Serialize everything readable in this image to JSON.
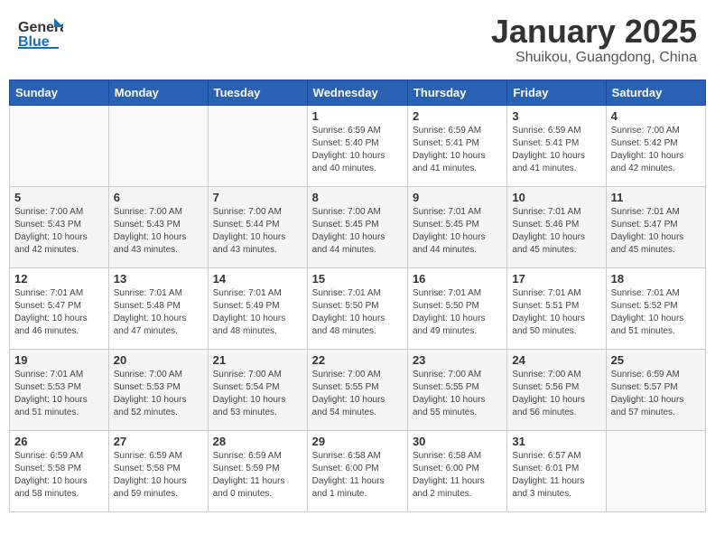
{
  "header": {
    "logo_general": "General",
    "logo_blue": "Blue",
    "month_title": "January 2025",
    "location": "Shuikou, Guangdong, China"
  },
  "days_of_week": [
    "Sunday",
    "Monday",
    "Tuesday",
    "Wednesday",
    "Thursday",
    "Friday",
    "Saturday"
  ],
  "weeks": [
    [
      {
        "day": "",
        "info": ""
      },
      {
        "day": "",
        "info": ""
      },
      {
        "day": "",
        "info": ""
      },
      {
        "day": "1",
        "info": "Sunrise: 6:59 AM\nSunset: 5:40 PM\nDaylight: 10 hours\nand 40 minutes."
      },
      {
        "day": "2",
        "info": "Sunrise: 6:59 AM\nSunset: 5:41 PM\nDaylight: 10 hours\nand 41 minutes."
      },
      {
        "day": "3",
        "info": "Sunrise: 6:59 AM\nSunset: 5:41 PM\nDaylight: 10 hours\nand 41 minutes."
      },
      {
        "day": "4",
        "info": "Sunrise: 7:00 AM\nSunset: 5:42 PM\nDaylight: 10 hours\nand 42 minutes."
      }
    ],
    [
      {
        "day": "5",
        "info": "Sunrise: 7:00 AM\nSunset: 5:43 PM\nDaylight: 10 hours\nand 42 minutes."
      },
      {
        "day": "6",
        "info": "Sunrise: 7:00 AM\nSunset: 5:43 PM\nDaylight: 10 hours\nand 43 minutes."
      },
      {
        "day": "7",
        "info": "Sunrise: 7:00 AM\nSunset: 5:44 PM\nDaylight: 10 hours\nand 43 minutes."
      },
      {
        "day": "8",
        "info": "Sunrise: 7:00 AM\nSunset: 5:45 PM\nDaylight: 10 hours\nand 44 minutes."
      },
      {
        "day": "9",
        "info": "Sunrise: 7:01 AM\nSunset: 5:45 PM\nDaylight: 10 hours\nand 44 minutes."
      },
      {
        "day": "10",
        "info": "Sunrise: 7:01 AM\nSunset: 5:46 PM\nDaylight: 10 hours\nand 45 minutes."
      },
      {
        "day": "11",
        "info": "Sunrise: 7:01 AM\nSunset: 5:47 PM\nDaylight: 10 hours\nand 45 minutes."
      }
    ],
    [
      {
        "day": "12",
        "info": "Sunrise: 7:01 AM\nSunset: 5:47 PM\nDaylight: 10 hours\nand 46 minutes."
      },
      {
        "day": "13",
        "info": "Sunrise: 7:01 AM\nSunset: 5:48 PM\nDaylight: 10 hours\nand 47 minutes."
      },
      {
        "day": "14",
        "info": "Sunrise: 7:01 AM\nSunset: 5:49 PM\nDaylight: 10 hours\nand 48 minutes."
      },
      {
        "day": "15",
        "info": "Sunrise: 7:01 AM\nSunset: 5:50 PM\nDaylight: 10 hours\nand 48 minutes."
      },
      {
        "day": "16",
        "info": "Sunrise: 7:01 AM\nSunset: 5:50 PM\nDaylight: 10 hours\nand 49 minutes."
      },
      {
        "day": "17",
        "info": "Sunrise: 7:01 AM\nSunset: 5:51 PM\nDaylight: 10 hours\nand 50 minutes."
      },
      {
        "day": "18",
        "info": "Sunrise: 7:01 AM\nSunset: 5:52 PM\nDaylight: 10 hours\nand 51 minutes."
      }
    ],
    [
      {
        "day": "19",
        "info": "Sunrise: 7:01 AM\nSunset: 5:53 PM\nDaylight: 10 hours\nand 51 minutes."
      },
      {
        "day": "20",
        "info": "Sunrise: 7:00 AM\nSunset: 5:53 PM\nDaylight: 10 hours\nand 52 minutes."
      },
      {
        "day": "21",
        "info": "Sunrise: 7:00 AM\nSunset: 5:54 PM\nDaylight: 10 hours\nand 53 minutes."
      },
      {
        "day": "22",
        "info": "Sunrise: 7:00 AM\nSunset: 5:55 PM\nDaylight: 10 hours\nand 54 minutes."
      },
      {
        "day": "23",
        "info": "Sunrise: 7:00 AM\nSunset: 5:55 PM\nDaylight: 10 hours\nand 55 minutes."
      },
      {
        "day": "24",
        "info": "Sunrise: 7:00 AM\nSunset: 5:56 PM\nDaylight: 10 hours\nand 56 minutes."
      },
      {
        "day": "25",
        "info": "Sunrise: 6:59 AM\nSunset: 5:57 PM\nDaylight: 10 hours\nand 57 minutes."
      }
    ],
    [
      {
        "day": "26",
        "info": "Sunrise: 6:59 AM\nSunset: 5:58 PM\nDaylight: 10 hours\nand 58 minutes."
      },
      {
        "day": "27",
        "info": "Sunrise: 6:59 AM\nSunset: 5:58 PM\nDaylight: 10 hours\nand 59 minutes."
      },
      {
        "day": "28",
        "info": "Sunrise: 6:59 AM\nSunset: 5:59 PM\nDaylight: 11 hours\nand 0 minutes."
      },
      {
        "day": "29",
        "info": "Sunrise: 6:58 AM\nSunset: 6:00 PM\nDaylight: 11 hours\nand 1 minute."
      },
      {
        "day": "30",
        "info": "Sunrise: 6:58 AM\nSunset: 6:00 PM\nDaylight: 11 hours\nand 2 minutes."
      },
      {
        "day": "31",
        "info": "Sunrise: 6:57 AM\nSunset: 6:01 PM\nDaylight: 11 hours\nand 3 minutes."
      },
      {
        "day": "",
        "info": ""
      }
    ]
  ]
}
